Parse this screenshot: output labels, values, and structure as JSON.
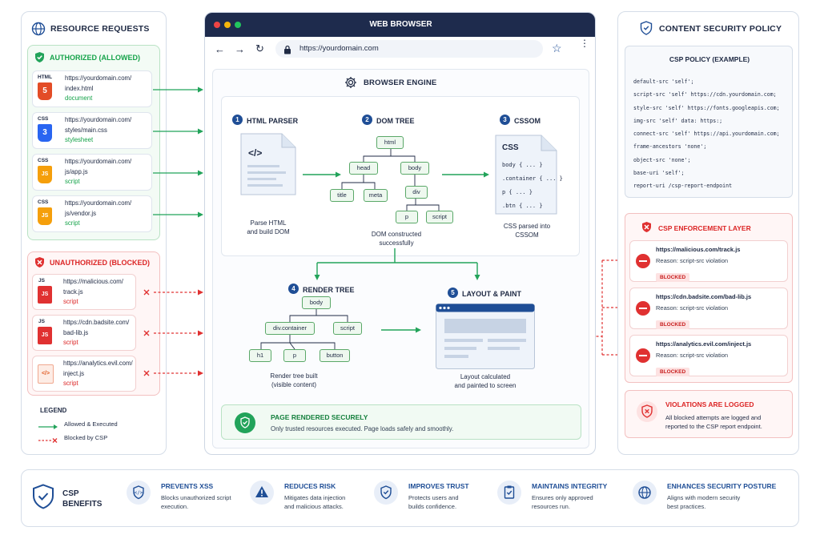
{
  "resource_requests": {
    "title": "RESOURCE REQUESTS",
    "authorized_title": "AUTHORIZED (ALLOWED)",
    "authorized": [
      {
        "tag": "HTML",
        "line1": "https://yourdomain.com/",
        "line2": "index.html",
        "type": "document"
      },
      {
        "tag": "CSS",
        "line1": "https://yourdomain.com/",
        "line2": "styles/main.css",
        "type": "stylesheet"
      },
      {
        "tag": "CSS",
        "line1": "https://yourdomain.com/",
        "line2": "js/app.js",
        "type": "script"
      },
      {
        "tag": "CSS",
        "line1": "https://yourdomain.com/",
        "line2": "js/vendor.js",
        "type": "script"
      }
    ],
    "unauthorized_title": "UNAUTHORIZED (BLOCKED)",
    "unauthorized": [
      {
        "tag": "JS",
        "line1": "https://malicious.com/",
        "line2": "track.js",
        "type": "script"
      },
      {
        "tag": "JS",
        "line1": "https://cdn.badsite.com/",
        "line2": "bad-lib.js",
        "type": "script"
      },
      {
        "tag": "",
        "line1": "https://analytics.evil.com/",
        "line2": "inject.js",
        "type": "script"
      }
    ],
    "legend_title": "LEGEND",
    "legend_allowed": "Allowed & Executed",
    "legend_blocked": "Blocked by CSP"
  },
  "browser": {
    "title": "WEB BROWSER",
    "url": "https://yourdomain.com",
    "engine_title": "BROWSER ENGINE",
    "steps": {
      "html_parser": {
        "num": "1",
        "title": "HTML PARSER",
        "caption1": "Parse HTML",
        "caption2": "and build DOM"
      },
      "dom_tree": {
        "num": "2",
        "title": "DOM TREE",
        "caption1": "DOM constructed",
        "caption2": "successfully"
      },
      "cssom": {
        "num": "3",
        "title": "CSSOM",
        "caption1": "CSS parsed into",
        "caption2": "CSSOM"
      },
      "render_tree": {
        "num": "4",
        "title": "RENDER TREE",
        "caption1": "Render tree built",
        "caption2": "(visible content)"
      },
      "layout_paint": {
        "num": "5",
        "title": "LAYOUT & PAINT",
        "caption1": "Layout calculated",
        "caption2": "and painted to screen"
      }
    },
    "dom_nodes": {
      "html": "html",
      "head": "head",
      "body": "body",
      "title": "title",
      "meta": "meta",
      "div": "div",
      "p": "p",
      "script": "script"
    },
    "render_nodes": {
      "body": "body",
      "divc": "div.container",
      "script": "script",
      "h1": "h1",
      "p": "p",
      "button": "button"
    },
    "cssom_doc": {
      "heading": "CSS",
      "lines": [
        "body { ... }",
        ".container { ... }",
        "p { ... }",
        ".btn { ... }"
      ]
    },
    "code_icon": "</>",
    "rendered_title": "PAGE RENDERED SECURELY",
    "rendered_desc": "Only trusted resources executed. Page loads safely and smoothly."
  },
  "csp": {
    "title": "CONTENT SECURITY POLICY",
    "policy_title": "CSP POLICY (EXAMPLE)",
    "policy_lines": [
      "default-src 'self';",
      "script-src 'self' https://cdn.yourdomain.com;",
      "style-src 'self' https://fonts.googleapis.com;",
      "img-src 'self' data: https:;",
      "connect-src 'self' https://api.yourdomain.com;",
      "frame-ancestors 'none';",
      "object-src 'none';",
      "base-uri 'self';",
      "report-uri /csp-report-endpoint"
    ],
    "enforcement_title": "CSP ENFORCEMENT LAYER",
    "violations": [
      {
        "url": "https://malicious.com/track.js",
        "reason": "Reason: script-src violation",
        "badge": "BLOCKED"
      },
      {
        "url": "https://cdn.badsite.com/bad-lib.js",
        "reason": "Reason: script-src violation",
        "badge": "BLOCKED"
      },
      {
        "url": "https://analytics.evil.com/inject.js",
        "reason": "Reason: script-src violation",
        "badge": "BLOCKED"
      }
    ],
    "logged_title": "VIOLATIONS ARE LOGGED",
    "logged_desc1": "All blocked attempts are logged and",
    "logged_desc2": "reported to the CSP report endpoint."
  },
  "benefits": {
    "title1": "CSP",
    "title2": "BENEFITS",
    "items": [
      {
        "title": "PREVENTS XSS",
        "d1": "Blocks unauthorized script",
        "d2": "execution.",
        "icon": "shield-code-icon"
      },
      {
        "title": "REDUCES RISK",
        "d1": "Mitigates data injection",
        "d2": "and malicious attacks.",
        "icon": "warning-icon"
      },
      {
        "title": "IMPROVES TRUST",
        "d1": "Protects users and",
        "d2": "builds confidence.",
        "icon": "shield-check-icon"
      },
      {
        "title": "MAINTAINS INTEGRITY",
        "d1": "Ensures only approved",
        "d2": "resources run.",
        "icon": "clipboard-check-icon"
      },
      {
        "title": "ENHANCES SECURITY POSTURE",
        "d1": "Aligns with modern security",
        "d2": "best practices.",
        "icon": "globe-icon"
      }
    ]
  },
  "colors": {
    "green": "#22a35a",
    "red": "#e03131",
    "navy": "#1f2a44",
    "blue": "#1f4e96"
  }
}
